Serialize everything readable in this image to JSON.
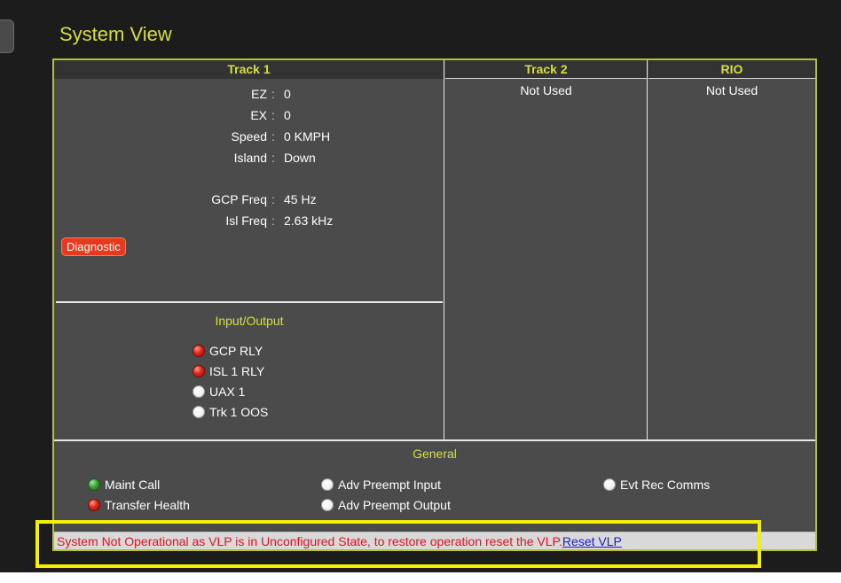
{
  "page": {
    "title": "System View"
  },
  "columns": {
    "track1": {
      "header": "Track 1"
    },
    "track2": {
      "header": "Track 2",
      "status": "Not Used"
    },
    "rio": {
      "header": "RIO",
      "status": "Not Used"
    }
  },
  "track1": {
    "fields": [
      {
        "key": "EZ",
        "sep": ":",
        "value": "0"
      },
      {
        "key": "EX",
        "sep": ":",
        "value": "0"
      },
      {
        "key": "Speed",
        "sep": ":",
        "value": "0 KMPH"
      },
      {
        "key": "Island",
        "sep": ":",
        "value": "Down"
      },
      {
        "key": "GCP Freq",
        "sep": ":",
        "value": "45 Hz"
      },
      {
        "key": "Isl Freq",
        "sep": ":",
        "value": "2.63 kHz"
      }
    ],
    "diagnostic_label": "Diagnostic",
    "io_title": "Input/Output",
    "io_items": [
      {
        "label": "GCP RLY",
        "state": "red"
      },
      {
        "label": "ISL 1 RLY",
        "state": "red"
      },
      {
        "label": "UAX 1",
        "state": "white"
      },
      {
        "label": "Trk 1 OOS",
        "state": "white"
      }
    ]
  },
  "general": {
    "title": "General",
    "items": [
      {
        "label": "Maint Call",
        "state": "green"
      },
      {
        "label": "Transfer Health",
        "state": "red"
      },
      {
        "label": "Adv Preempt Input",
        "state": "white"
      },
      {
        "label": "Adv Preempt Output",
        "state": "white"
      },
      {
        "label": "Evt Rec Comms",
        "state": "white"
      }
    ]
  },
  "status": {
    "message": "System Not Operational as VLP is in Unconfigured State, to restore operation reset the VLP.",
    "link_label": "Reset VLP"
  },
  "colors": {
    "accent": "#d6df3f",
    "panel_border": "#b4bf3a",
    "error_text": "#e0141e",
    "link": "#1a1ad0",
    "highlight": "#f4f000"
  }
}
